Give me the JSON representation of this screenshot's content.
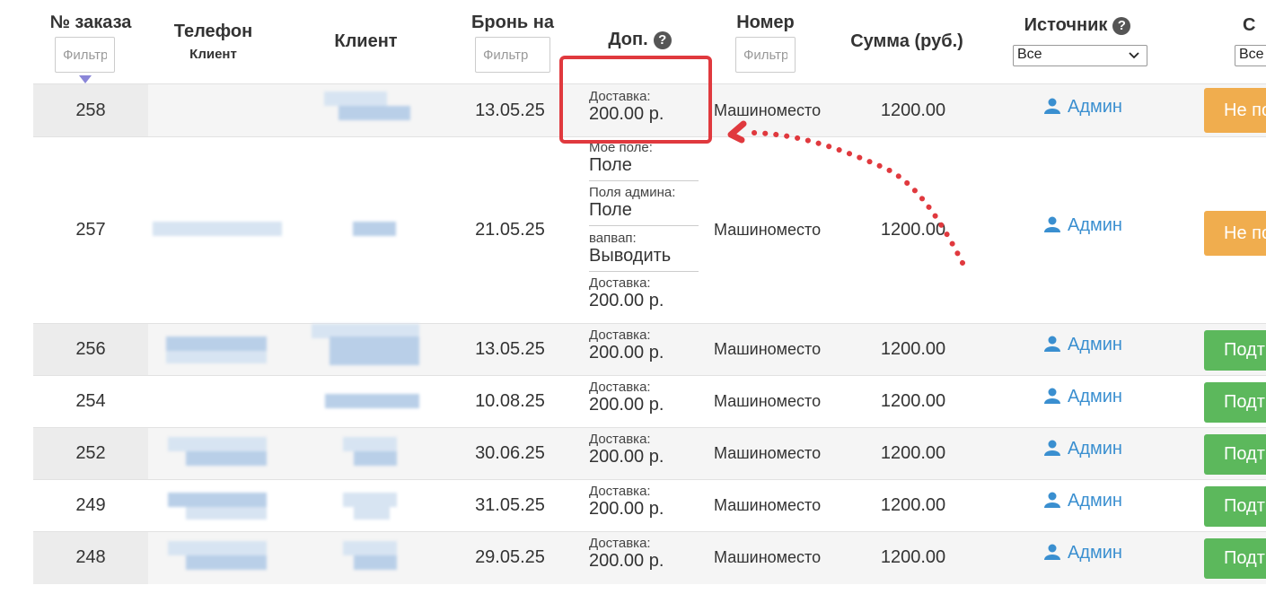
{
  "header": {
    "order_no": "№ заказа",
    "phone": "Телефон",
    "phone_sub": "Клиент",
    "client": "Клиент",
    "booking_for": "Бронь на",
    "extra": "Доп.",
    "number": "Номер",
    "sum": "Сумма (руб.)",
    "source": "Источник",
    "status_partial": "С"
  },
  "filters": {
    "order_placeholder": "Фильтр",
    "date_placeholder": "Фильтр",
    "number_placeholder": "Фильтр",
    "source_selected": "Все",
    "status_selected": "Все"
  },
  "colors": {
    "status_pending": "#f0ad4e",
    "status_confirmed": "#5cb85c",
    "admin_link": "#3a8fd0",
    "annotation": "#e0393e"
  },
  "icons": {
    "help": "question-circle-icon",
    "sort": "sort-down-triangle-icon",
    "user": "user-icon",
    "dropdown": "chevron-down-icon"
  },
  "rows": [
    {
      "order": "258",
      "date": "13.05.25",
      "number": "Машиноместо",
      "sum": "1200.00",
      "source": "Админ",
      "status": "Не подтверждён",
      "extras": [
        {
          "label": "Доставка:",
          "value": "200.00 р."
        }
      ]
    },
    {
      "order": "257",
      "date": "21.05.25",
      "number": "Машиноместо",
      "sum": "1200.00",
      "source": "Админ",
      "status": "Не подтверждён",
      "extras": [
        {
          "label": "Мое поле:",
          "value": "Поле"
        },
        {
          "label": "Поля админа:",
          "value": "Поле"
        },
        {
          "label": "вапвап:",
          "value": "Выводить"
        },
        {
          "label": "Доставка:",
          "value": "200.00 р."
        }
      ]
    },
    {
      "order": "256",
      "date": "13.05.25",
      "number": "Машиноместо",
      "sum": "1200.00",
      "source": "Админ",
      "status": "Подтверждён",
      "extras": [
        {
          "label": "Доставка:",
          "value": "200.00 р."
        }
      ]
    },
    {
      "order": "254",
      "date": "10.08.25",
      "number": "Машиноместо",
      "sum": "1200.00",
      "source": "Админ",
      "status": "Подтверждён",
      "extras": [
        {
          "label": "Доставка:",
          "value": "200.00 р."
        }
      ]
    },
    {
      "order": "252",
      "date": "30.06.25",
      "number": "Машиноместо",
      "sum": "1200.00",
      "source": "Админ",
      "status": "Подтверждён",
      "extras": [
        {
          "label": "Доставка:",
          "value": "200.00 р."
        }
      ]
    },
    {
      "order": "249",
      "date": "31.05.25",
      "number": "Машиноместо",
      "sum": "1200.00",
      "source": "Админ",
      "status": "Подтверждён",
      "extras": [
        {
          "label": "Доставка:",
          "value": "200.00 р."
        }
      ]
    },
    {
      "order": "248",
      "date": "29.05.25",
      "number": "Машиноместо",
      "sum": "1200.00",
      "source": "Админ",
      "status": "Подтверждён",
      "extras": [
        {
          "label": "Доставка:",
          "value": "200.00 р."
        }
      ]
    }
  ]
}
